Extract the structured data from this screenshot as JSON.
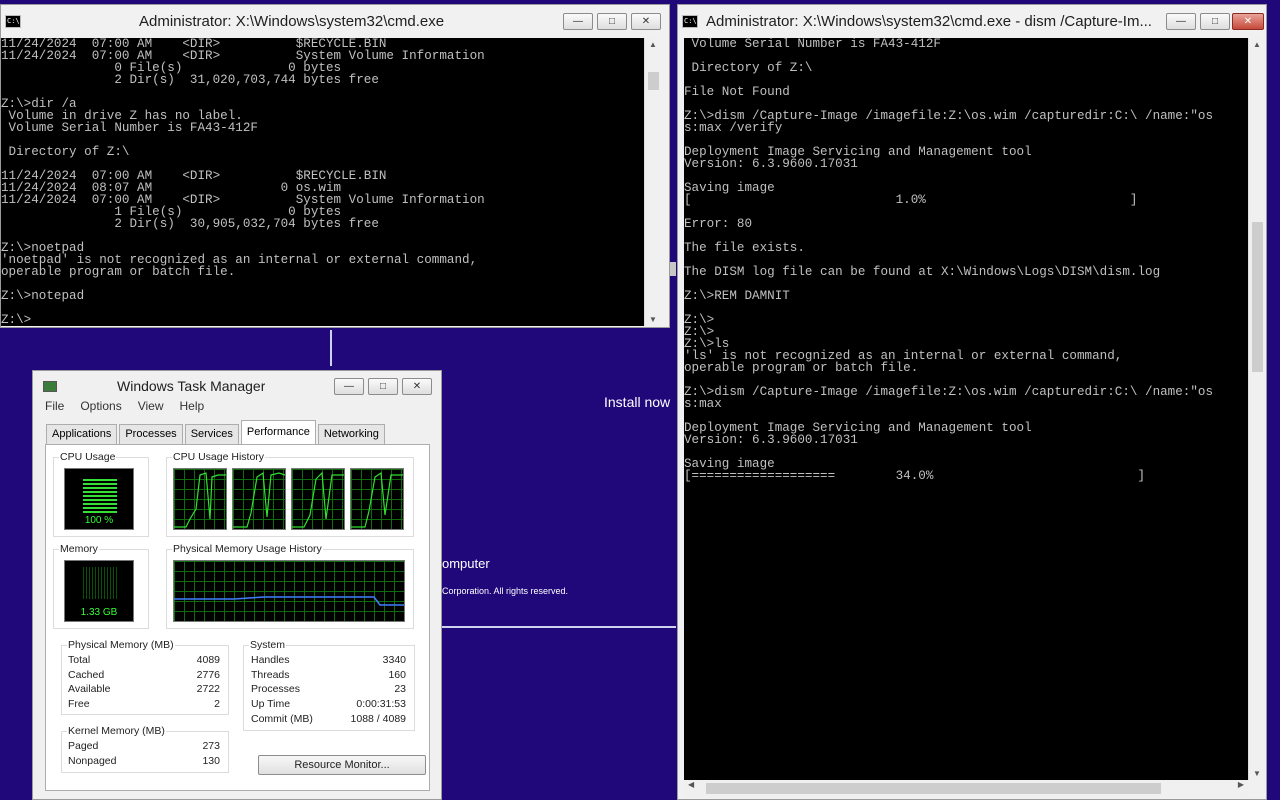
{
  "background": {
    "install_now": "Install now",
    "computer_text": "omputer",
    "copyright": "Corporation. All rights reserved."
  },
  "cmd_left": {
    "icon_text": "C:\\",
    "title": "Administrator: X:\\Windows\\system32\\cmd.exe",
    "lines": [
      "11/24/2024  07:00 AM    <DIR>          $RECYCLE.BIN",
      "11/24/2024  07:00 AM    <DIR>          System Volume Information",
      "               0 File(s)              0 bytes",
      "               2 Dir(s)  31,020,703,744 bytes free",
      "",
      "Z:\\>dir /a",
      " Volume in drive Z has no label.",
      " Volume Serial Number is FA43-412F",
      "",
      " Directory of Z:\\",
      "",
      "11/24/2024  07:00 AM    <DIR>          $RECYCLE.BIN",
      "11/24/2024  08:07 AM                 0 os.wim",
      "11/24/2024  07:00 AM    <DIR>          System Volume Information",
      "               1 File(s)              0 bytes",
      "               2 Dir(s)  30,905,032,704 bytes free",
      "",
      "Z:\\>noetpad",
      "'noetpad' is not recognized as an internal or external command,",
      "operable program or batch file.",
      "",
      "Z:\\>notepad",
      "",
      "Z:\\>"
    ]
  },
  "cmd_right": {
    "icon_text": "C:\\",
    "title": "Administrator: X:\\Windows\\system32\\cmd.exe - dism  /Capture-Im...",
    "lines": [
      " Volume Serial Number is FA43-412F",
      "",
      " Directory of Z:\\",
      "",
      "File Not Found",
      "",
      "Z:\\>dism /Capture-Image /imagefile:Z:\\os.wim /capturedir:C:\\ /name:\"os",
      "s:max /verify",
      "",
      "Deployment Image Servicing and Management tool",
      "Version: 6.3.9600.17031",
      "",
      "Saving image",
      "[                           1.0%                           ]",
      "",
      "Error: 80",
      "",
      "The file exists.",
      "",
      "The DISM log file can be found at X:\\Windows\\Logs\\DISM\\dism.log",
      "",
      "Z:\\>REM DAMNIT",
      "",
      "Z:\\>",
      "Z:\\>",
      "Z:\\>ls",
      "'ls' is not recognized as an internal or external command,",
      "operable program or batch file.",
      "",
      "Z:\\>dism /Capture-Image /imagefile:Z:\\os.wim /capturedir:C:\\ /name:\"os",
      "s:max",
      "",
      "Deployment Image Servicing and Management tool",
      "Version: 6.3.9600.17031",
      "",
      "Saving image",
      "[===================        34.0%                           ]"
    ]
  },
  "task_manager": {
    "title": "Windows Task Manager",
    "menu": [
      "File",
      "Options",
      "View",
      "Help"
    ],
    "tabs": [
      "Applications",
      "Processes",
      "Services",
      "Performance",
      "Networking"
    ],
    "active_tab": "Performance",
    "cpu_usage_label": "CPU Usage",
    "cpu_usage_value": "100 %",
    "cpu_history_label": "CPU Usage History",
    "memory_label": "Memory",
    "memory_value": "1.33 GB",
    "physical_history_label": "Physical Memory Usage History",
    "physical_memory": {
      "label": "Physical Memory (MB)",
      "rows": [
        {
          "k": "Total",
          "v": "4089"
        },
        {
          "k": "Cached",
          "v": "2776"
        },
        {
          "k": "Available",
          "v": "2722"
        },
        {
          "k": "Free",
          "v": "2"
        }
      ]
    },
    "system": {
      "label": "System",
      "rows": [
        {
          "k": "Handles",
          "v": "3340"
        },
        {
          "k": "Threads",
          "v": "160"
        },
        {
          "k": "Processes",
          "v": "23"
        },
        {
          "k": "Up Time",
          "v": "0:00:31:53"
        },
        {
          "k": "Commit (MB)",
          "v": "1088 / 4089"
        }
      ]
    },
    "kernel_memory": {
      "label": "Kernel Memory (MB)",
      "rows": [
        {
          "k": "Paged",
          "v": "273"
        },
        {
          "k": "Nonpaged",
          "v": "130"
        }
      ]
    },
    "resource_monitor_label": "Resource Monitor...",
    "colors": {
      "graph_line": "#33e033",
      "memory_line": "#3f7fff"
    }
  }
}
